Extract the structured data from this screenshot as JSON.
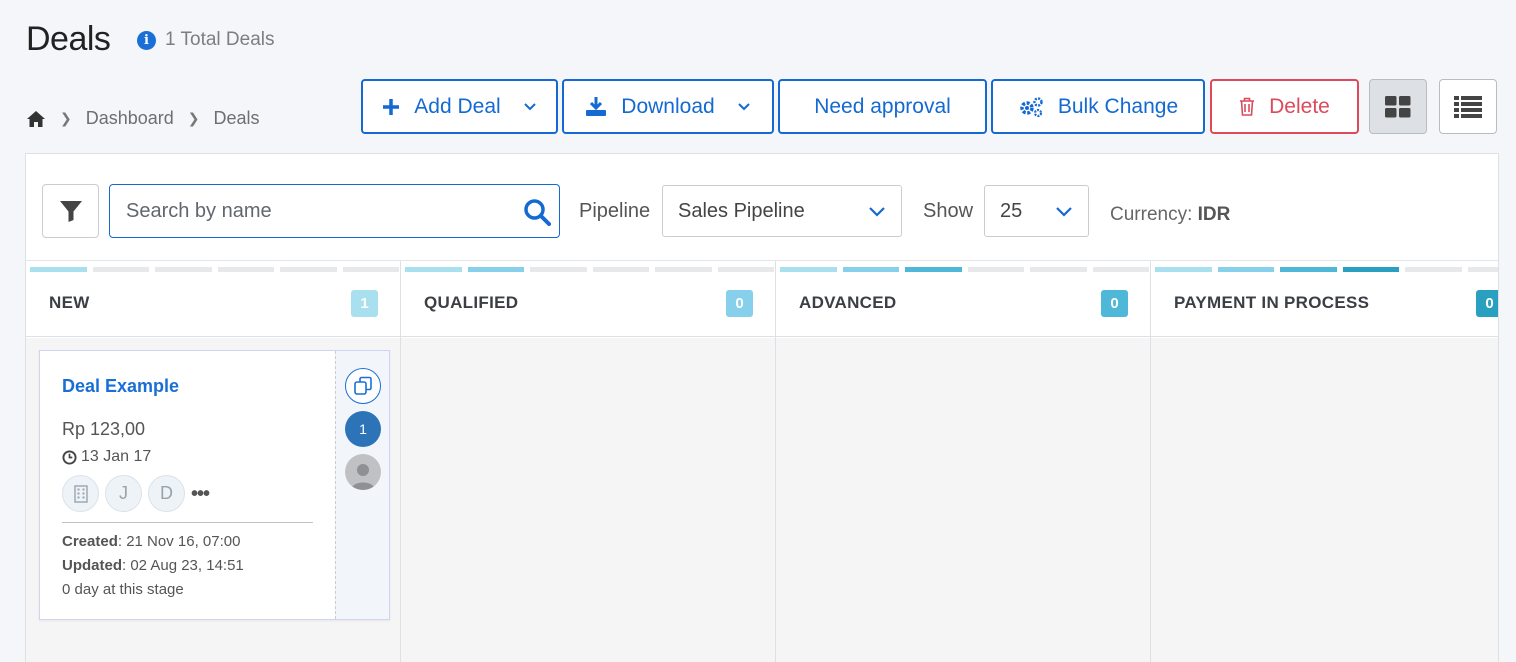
{
  "header": {
    "title": "Deals",
    "total_text": "1 Total Deals",
    "info_icon": "info-icon"
  },
  "breadcrumb": {
    "home_icon": "home-icon",
    "items": [
      "Dashboard",
      "Deals"
    ]
  },
  "toolbar": {
    "add_deal": "Add Deal",
    "download": "Download",
    "need_approval": "Need approval",
    "bulk_change": "Bulk Change",
    "delete": "Delete",
    "view_grid_icon": "grid-view-icon",
    "view_list_icon": "list-view-icon",
    "accent": "#1469d2",
    "danger": "#dc4a5c"
  },
  "filters": {
    "search_placeholder": "Search by name",
    "pipeline_label": "Pipeline",
    "pipeline_value": "Sales Pipeline",
    "show_label": "Show",
    "show_value": "25",
    "currency_label": "Currency:",
    "currency_value": "IDR"
  },
  "columns": [
    {
      "title": "NEW",
      "count": "1",
      "color": "#a9e0f0"
    },
    {
      "title": "QUALIFIED",
      "count": "0",
      "color": "#86d0ec"
    },
    {
      "title": "ADVANCED",
      "count": "0",
      "color": "#4fb8d8"
    },
    {
      "title": "PAYMENT IN PROCESS",
      "count": "0",
      "color": "#2aa0c0"
    }
  ],
  "deal_card": {
    "name": "Deal Example",
    "amount": "Rp 123,00",
    "date": "13 Jan 17",
    "avatar_j": "J",
    "avatar_d": "D",
    "created_label": "Created",
    "created_value": ": 21 Nov 16, 07:00",
    "updated_label": "Updated",
    "updated_value": ": 02 Aug 23, 14:51",
    "stage_text": "0 day at this stage",
    "side_number": "1"
  }
}
